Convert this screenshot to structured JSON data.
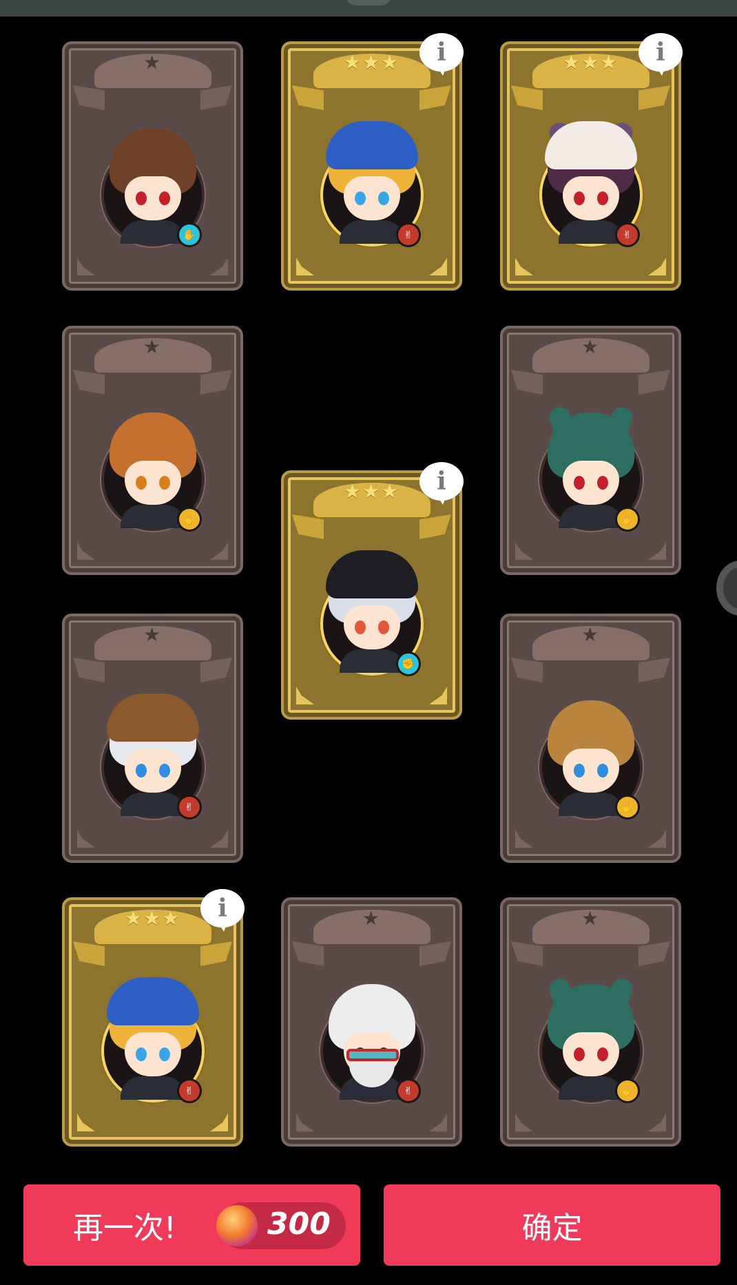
{
  "cards": [
    {
      "id": "c1",
      "rarity": "brown",
      "stars": "★",
      "badge": "cyan",
      "badge_glyph": "✋",
      "info": false,
      "hair": "#6e4128",
      "eyes": "#c4202c"
    },
    {
      "id": "c2",
      "rarity": "gold",
      "stars": "★★★",
      "badge": "red",
      "badge_glyph": "✌",
      "info": true,
      "hair": "#f0b33a",
      "eyes": "#3aa6e6",
      "hat": "#2d5fc4"
    },
    {
      "id": "c3",
      "rarity": "gold",
      "stars": "★★★",
      "badge": "red",
      "badge_glyph": "✌",
      "info": true,
      "hair": "#4e2c46",
      "eyes": "#c4202c",
      "hat": "#f2ebe6",
      "ears": "#6a5078"
    },
    {
      "id": "c4",
      "rarity": "brown",
      "stars": "★",
      "badge": "yellow",
      "badge_glyph": "✋",
      "info": false,
      "hair": "#c4702e",
      "eyes": "#d8801e"
    },
    {
      "id": "c5",
      "rarity": "gold",
      "stars": "★★★",
      "badge": "cyan",
      "badge_glyph": "✊",
      "info": true,
      "hair": "#d9dde6",
      "eyes": "#e2563a",
      "hat": "#1e1e24"
    },
    {
      "id": "c6",
      "rarity": "brown",
      "stars": "★",
      "badge": "yellow",
      "badge_glyph": "✋",
      "info": false,
      "hair": "#2e6e62",
      "eyes": "#c4202c",
      "ears": "#2e6e62"
    },
    {
      "id": "c7",
      "rarity": "brown",
      "stars": "★",
      "badge": "red",
      "badge_glyph": "✌",
      "info": false,
      "hair": "#e6e8ef",
      "eyes": "#2f8ee0",
      "hat": "#8a5a2e"
    },
    {
      "id": "c8",
      "rarity": "brown",
      "stars": "★",
      "badge": "yellow",
      "badge_glyph": "✋",
      "info": false,
      "hair": "#b8843e",
      "eyes": "#2f8ee0"
    },
    {
      "id": "c9",
      "rarity": "gold",
      "stars": "★★★",
      "badge": "red",
      "badge_glyph": "✌",
      "info": true,
      "hair": "#f0b33a",
      "eyes": "#3aa6e6",
      "hat": "#2d5fc4"
    },
    {
      "id": "c10",
      "rarity": "brown",
      "stars": "★",
      "badge": "red",
      "badge_glyph": "✌",
      "info": false,
      "hair": "#ececec",
      "eyes": "#333333",
      "glasses": true
    },
    {
      "id": "c11",
      "rarity": "brown",
      "stars": "★",
      "badge": "yellow",
      "badge_glyph": "✋",
      "info": false,
      "hair": "#2e6e62",
      "eyes": "#c4202c",
      "ears": "#2e6e62"
    }
  ],
  "info_glyph": "i",
  "buttons": {
    "again_label": "再一次!",
    "cost_value": "300",
    "confirm_label": "确定"
  },
  "colors": {
    "button": "#ef3a5a",
    "gold_card": "#8d742e",
    "brown_card": "#5b4b48"
  }
}
